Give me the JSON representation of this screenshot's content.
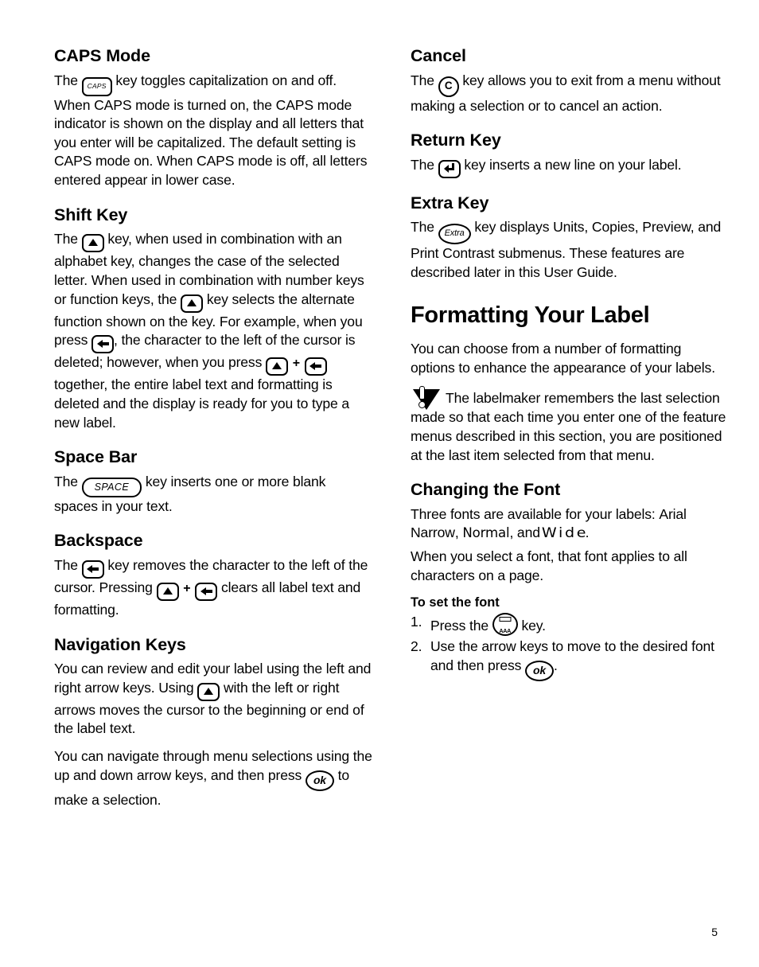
{
  "page": {
    "number": "5"
  },
  "left_column": {
    "sections": [
      {
        "id": "caps-mode",
        "heading": "CAPS Mode",
        "text_before_key": "The",
        "key": "CAPS",
        "text_after_key": "key toggles capitalization on and off. When CAPS mode is turned on, the CAPS mode indicator is shown on the display and all letters that you enter will be capitalized. The default setting is CAPS mode on. When CAPS mode is off, all letters entered appear in lower case."
      },
      {
        "id": "shift-key",
        "heading": "Shift Key",
        "p1_a": "The",
        "p1_b": "key, when used in combination with an alphabet key, changes the case of the selected letter. When used in combination with number keys or function keys, the",
        "p1_c": "key selects the alternate function shown on the key. For example, when you press",
        "p1_d": ", the character to the left of the cursor is deleted; however, when you press",
        "p1_e": "+",
        "p1_f": "together, the entire label text and formatting is deleted and the display is ready for you to type a new label."
      },
      {
        "id": "space-bar",
        "heading": "Space Bar",
        "text_before_key": "The",
        "key": "SPACE",
        "text_after_key": "key inserts one or more blank spaces in your text."
      },
      {
        "id": "backspace",
        "heading": "Backspace",
        "p1_a": "The",
        "p1_b": "key removes the character to the left of the cursor. Pressing",
        "p1_c": "+",
        "p1_d": "clears all label text and formatting."
      },
      {
        "id": "navigation-keys",
        "heading": "Navigation Keys",
        "p1_a": "You can review and edit your label using the left and right arrow keys. Using",
        "p1_b": "with the left or right arrows moves the cursor to the beginning or end of the label text.",
        "p2_a": "You can navigate through menu selections using the up and down arrow keys, and then press",
        "p2_b": "to make a selection."
      }
    ]
  },
  "right_column": {
    "sections": [
      {
        "id": "cancel",
        "heading": "Cancel",
        "text_before_key": "The",
        "key": "C",
        "text_after_key": "key allows you to exit from a menu without making a selection or to cancel an action."
      },
      {
        "id": "return-key",
        "heading": "Return Key",
        "text_before_key": "The",
        "text_after_key": "key inserts a new line on your label."
      },
      {
        "id": "extra-key",
        "heading": "Extra Key",
        "text_before_key": "The",
        "key": "Extra",
        "text_after_key": "key displays Units, Copies, Preview, and Print Contrast submenus. These features are described later in this User Guide."
      }
    ],
    "chapter_heading": "Formatting Your Label",
    "formatting_intro": "You can choose from a number of formatting options to enhance the appearance of your labels.",
    "tip_text": "The labelmaker remembers the last selection made so that each time you enter one of the feature menus described in this section, you are positioned at the last item selected from that menu.",
    "changing_font": {
      "heading": "Changing the Font",
      "intro_a": "Three fonts are available for your labels:",
      "font_1": "Arial Narrow",
      "intro_b": ",",
      "font_2": "Normal",
      "intro_c": ", and",
      "font_3": "Wide",
      "intro_d": ".",
      "apply_text": "When you select a font, that font applies to all characters on a page.",
      "procedure_heading": "To set the font",
      "step_1_a": "Press the",
      "step_1_b": "key.",
      "step_2_a": "Use the arrow keys to move to the desired font and then press",
      "step_2_b": "."
    }
  },
  "icons": {
    "caps_key": "caps-key-icon",
    "shift_key": "shift-key-icon",
    "backspace_key": "backspace-key-icon",
    "space_key": "space-key-icon",
    "ok_key": "ok-key-icon",
    "cancel_key": "cancel-key-icon",
    "return_key": "return-key-icon",
    "extra_key": "extra-key-icon",
    "font_key": "font-key-icon",
    "tip": "tip-icon"
  },
  "colors": {
    "text": "#000000",
    "background": "#ffffff"
  }
}
